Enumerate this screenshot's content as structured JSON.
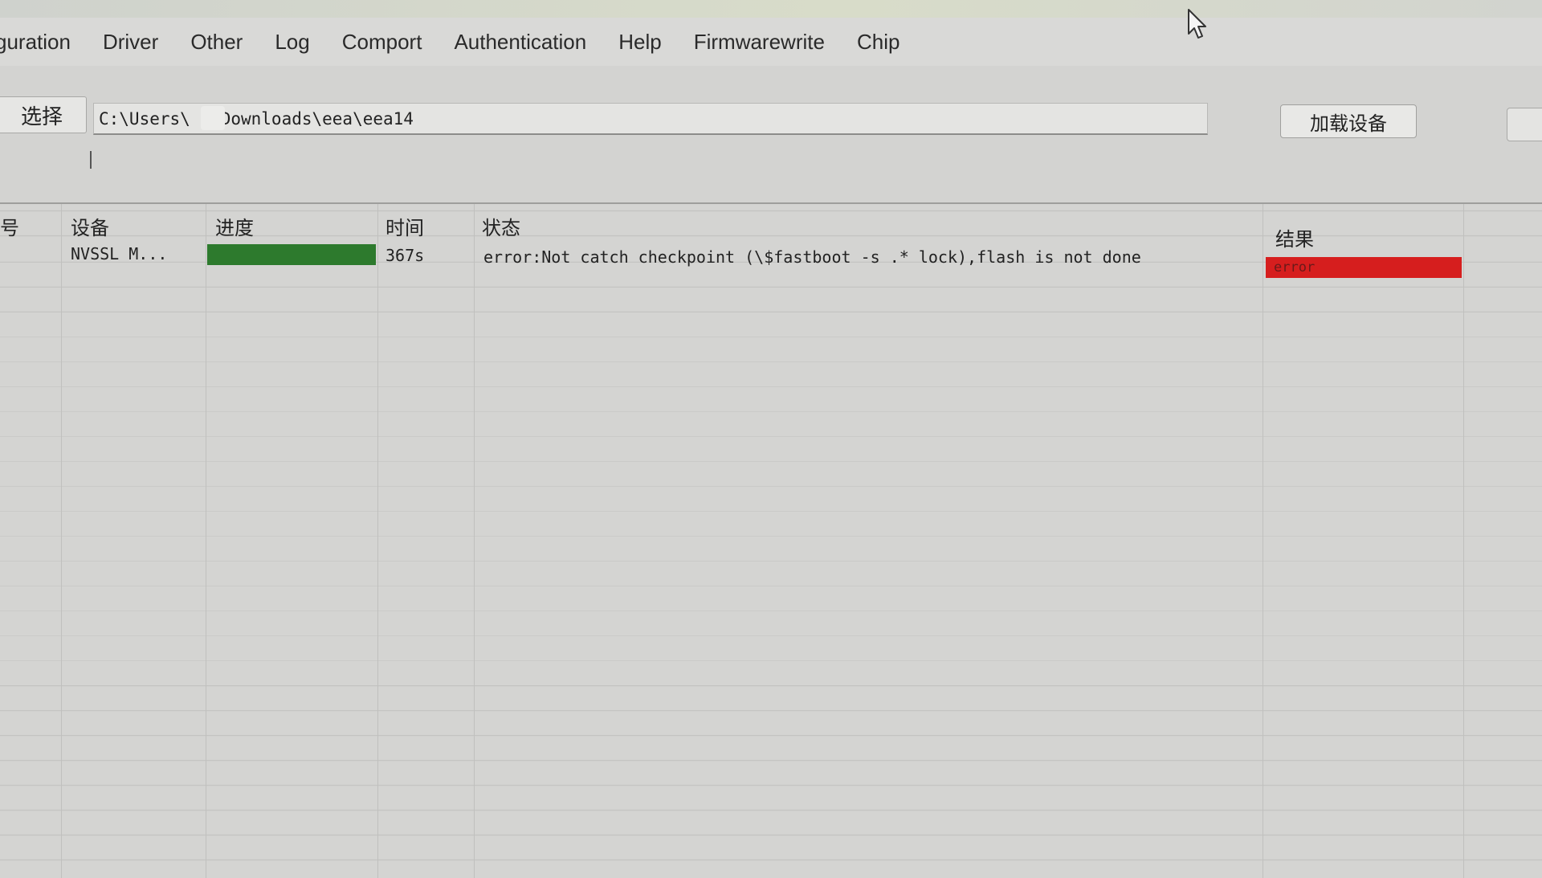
{
  "menu": {
    "items": [
      {
        "label": "guration"
      },
      {
        "label": "Driver"
      },
      {
        "label": "Other"
      },
      {
        "label": "Log"
      },
      {
        "label": "Comport"
      },
      {
        "label": "Authentication"
      },
      {
        "label": "Help"
      },
      {
        "label": "Firmwarewrite"
      },
      {
        "label": "Chip"
      }
    ]
  },
  "toolbar": {
    "select_label": "选择",
    "path_value": "C:\\Users\\    .\\Downloads\\eea\\eea14",
    "load_device_label": "加载设备"
  },
  "table": {
    "headers": {
      "index": "号",
      "device": "设备",
      "progress": "进度",
      "time": "时间",
      "status": "状态",
      "result": "结果"
    },
    "rows": [
      {
        "device": "NVSSL   M...",
        "progress_fraction": 1.0,
        "time": "367s",
        "status": "error:Not catch checkpoint (\\$fastboot -s .* lock),flash is not done",
        "result": "error"
      }
    ]
  },
  "colors": {
    "progress_fill": "#2d7a2d",
    "result_error": "#d61e1e"
  },
  "icons": {
    "cursor": "mouse-pointer-icon"
  }
}
